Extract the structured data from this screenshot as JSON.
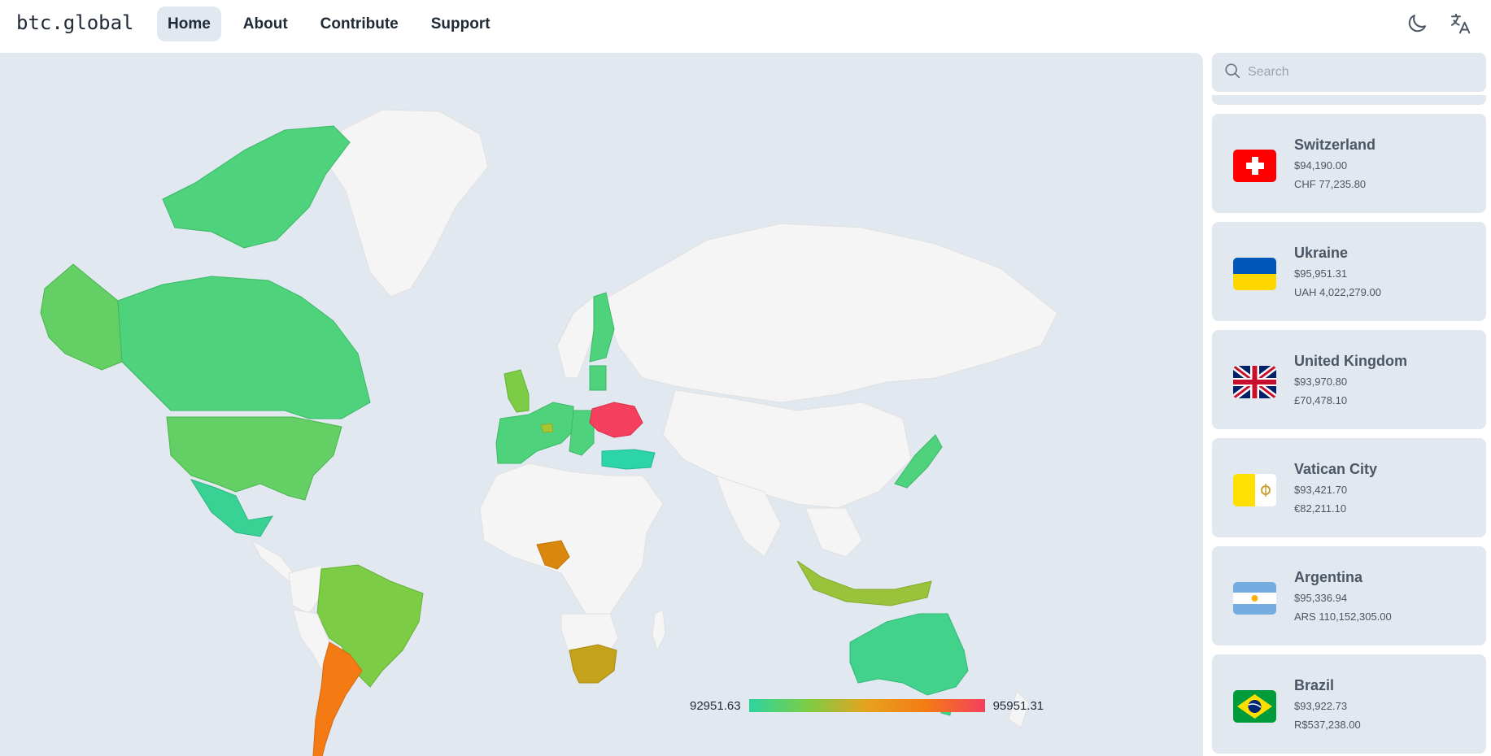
{
  "app": {
    "logo": "btc.global"
  },
  "nav": [
    {
      "label": "Home",
      "active": true
    },
    {
      "label": "About",
      "active": false
    },
    {
      "label": "Contribute",
      "active": false
    },
    {
      "label": "Support",
      "active": false
    }
  ],
  "header_icons": [
    "moon-icon",
    "translate-icon"
  ],
  "search": {
    "placeholder": "Search"
  },
  "legend": {
    "min": "92951.63",
    "max": "95951.31"
  },
  "colors": {
    "low": "#2dd4a0",
    "mid": "#e7a11e",
    "high": "#f43f5e",
    "panel": "#e2e8f0"
  },
  "countries": [
    {
      "name": "Switzerland",
      "usd": "$94,190.00",
      "local": "CHF 77,235.80",
      "flag": "switzerland-flag"
    },
    {
      "name": "Ukraine",
      "usd": "$95,951.31",
      "local": "UAH 4,022,279.00",
      "flag": "ukraine-flag"
    },
    {
      "name": "United Kingdom",
      "usd": "$93,970.80",
      "local": "£70,478.10",
      "flag": "uk-flag"
    },
    {
      "name": "Vatican City",
      "usd": "$93,421.70",
      "local": "€82,211.10",
      "flag": "vatican-flag"
    },
    {
      "name": "Argentina",
      "usd": "$95,336.94",
      "local": "ARS 110,152,305.00",
      "flag": "argentina-flag"
    },
    {
      "name": "Brazil",
      "usd": "$93,922.73",
      "local": "R$537,238.00",
      "flag": "brazil-flag"
    }
  ]
}
